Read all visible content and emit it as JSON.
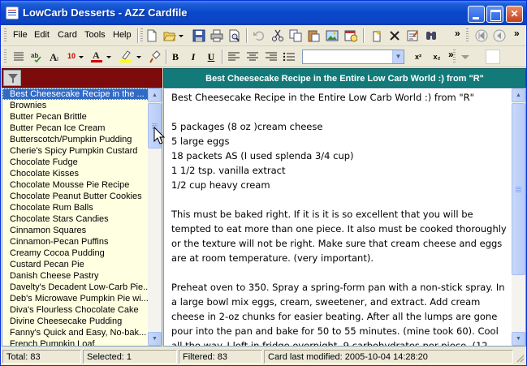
{
  "window": {
    "title": "LowCarb Desserts - AZZ Cardfile"
  },
  "menu": {
    "items": [
      "File",
      "Edit",
      "Card",
      "Tools",
      "Help"
    ],
    "overflow": "»"
  },
  "format_toolbar": {
    "font_size": "10",
    "bold_label": "B",
    "italic_label": "I",
    "underline_label": "U",
    "superscript_label": "x²",
    "subscript_label": "x₂",
    "font_combo_value": "",
    "overflow": "»"
  },
  "card_list": {
    "items": [
      "Best Cheesecake Recipe in the ...",
      "Brownies",
      "Butter Pecan Brittle",
      "Butter Pecan Ice Cream",
      "Butterscotch/Pumpkin Pudding",
      "Cherie's Spicy Pumpkin Custard",
      "Chocolate Fudge",
      "Chocolate Kisses",
      "Chocolate Mousse Pie Recipe",
      "Chocolate Peanut Butter Cookies",
      "Chocolate Rum Balls",
      "Chocolate Stars Candies",
      "Cinnamon Squares",
      "Cinnamon-Pecan Puffins",
      "Creamy Cocoa Pudding",
      "Custard Pecan Pie",
      "Danish Cheese Pastry",
      "Davelty's Decadent Low-Carb Pie...",
      "Deb's Microwave Pumpkin Pie wi...",
      "Diva's Flourless Chocolate Cake",
      "Divine Cheesecake Pudding",
      "Fanny's Quick and Easy, No-bak...",
      "French Pumpkin Loaf"
    ],
    "selected_index": 0
  },
  "card": {
    "header": "Best Cheesecake Recipe in the Entire Low Carb World :) from \"R\"",
    "body": "Best Cheesecake Recipe in the Entire Low Carb World :) from \"R\"\n\n5 packages (8 oz )cream cheese\n5 large eggs\n18 packets AS (I used splenda 3/4 cup)\n1 1/2 tsp. vanilla extract\n1/2 cup heavy cream\n\nThis must be baked right. If it is it is so excellent that you will be tempted to eat more than one piece. It also must be cooked thoroughly or the texture will not be right. Make sure that cream cheese and eggs are at room temperature. (very important).\n\nPreheat oven to 350. Spray a spring-form pan with a non-stick spray. In a large bowl mix eggs, cream, sweetener, and extract. Add cream cheese in 2-oz chunks for easier beating. After all the lumps are gone pour into the pan and bake for 50 to 55 minutes. (mine took 60). Cool all the way. I left in fridge overnight. 9 carbohydrates per piece. (12"
  },
  "status": {
    "total": "Total: 83",
    "selected": "Selected: 1",
    "filtered": "Filtered: 83",
    "modified": "Card last modified: 2005-10-04  14:28:20"
  },
  "colors": {
    "title_bar": "#0a46c9",
    "filter_row": "#7d0b0b",
    "card_header": "#137a7a",
    "list_background": "#ffffe1",
    "selection": "#316ac5"
  }
}
